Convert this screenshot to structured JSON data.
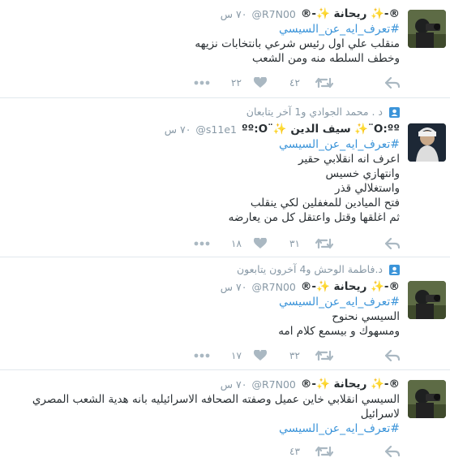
{
  "tweets": [
    {
      "context": "",
      "fullname": "®-✨ ريحانة ✨-®",
      "username": "@R7N00",
      "time": "٧٠ س",
      "lines": [],
      "hashtag": "#تعرف_ايه_عن_السيسي",
      "body_after": [
        "منقلب علي اول رئيس شرعي بانتخابات نزيهه",
        "وخطف السلطه منه ومن الشعب"
      ],
      "retweets": "٤٢",
      "likes": "٢٢"
    },
    {
      "context": "د . محمد الجوادي و1 آخر يتابعان",
      "fullname": "O:ºº¨✨ سيف الدين ✨¨ºº:O",
      "username": "@s11e1",
      "time": "٧٠ س",
      "lines": [],
      "hashtag": "#تعرف_ايه_عن_السيسي",
      "body_after": [
        "اعرف انه انقلابي حقير",
        "وانتهازي خسيس",
        "واستغلالي قذر",
        "فتح الميادين للمغفلين لكي ينقلب",
        "ثم اغلقها وقتل واعتقل كل من يعارضه"
      ],
      "retweets": "٣١",
      "likes": "١٨"
    },
    {
      "context": "د.فاطمة الوحش و4 آخرون يتابعون",
      "fullname": "®-✨ ريحانة ✨-®",
      "username": "@R7N00",
      "time": "٧٠ س",
      "lines": [],
      "hashtag": "#تعرف_ايه_عن_السيسي",
      "body_after": [
        "السيسي نحنوح",
        "ومسهوك و بيسمع كلام امه"
      ],
      "retweets": "٣٢",
      "likes": "١٧"
    },
    {
      "context": "",
      "fullname": "®-✨ ريحانة ✨-®",
      "username": "@R7N00",
      "time": "٧٠ س",
      "lines": [
        "السيسي انقلابي خاين عميل وصفته الصحافه الاسرائيليه بانه هدية الشعب المصري",
        "لاسرائيل"
      ],
      "hashtag": "#تعرف_ايه_عن_السيسي",
      "body_after": [],
      "retweets": "٤٣",
      "likes": ""
    }
  ]
}
